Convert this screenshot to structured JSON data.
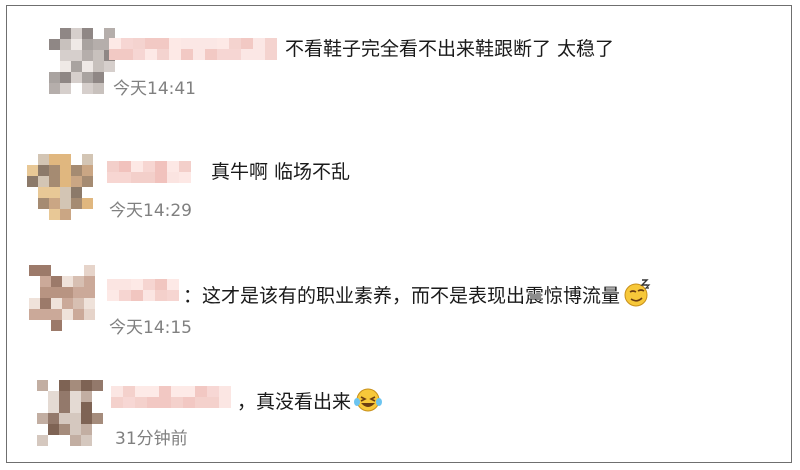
{
  "comments": [
    {
      "separator": "",
      "text": "不看鞋子完全看不出来鞋跟断了 太稳了",
      "time": "今天14:41",
      "emoji": "",
      "avatar_palette": [
        "#a9a3a0",
        "#d6cfcc",
        "#8f8785",
        "#c8c1bd",
        "#efe9e6",
        "#b5aeab"
      ],
      "name_palette": [
        "#f6d6d3",
        "#f2c9c4",
        "#fbe7e5",
        "#f4d3cf",
        "#fde9e6"
      ]
    },
    {
      "separator": "",
      "text": "真牛啊 临场不乱",
      "time": "今天14:29",
      "emoji": "",
      "avatar_palette": [
        "#caa684",
        "#e0b77f",
        "#a58b72",
        "#d3c5b4",
        "#8c7a6a",
        "#e8c896"
      ],
      "name_palette": [
        "#f7d6d2",
        "#f1c2bd",
        "#fbe4e1",
        "#f3cfca",
        "#fde8e5"
      ]
    },
    {
      "separator": "：",
      "text": "这才是该有的职业素养，而不是表现出震惊博流量",
      "time": "今天14:15",
      "emoji": "smirk-emoji",
      "avatar_palette": [
        "#d7bfb2",
        "#b89482",
        "#e6d4ca",
        "#9c7a6a",
        "#cba999",
        "#efe2da"
      ],
      "name_palette": [
        "#f6d5d1",
        "#f1c6c0",
        "#fbe5e2",
        "#f4d0cb",
        "#fde9e6"
      ]
    },
    {
      "separator": "，",
      "text": "真没看出来",
      "time": "31分钟前",
      "emoji": "laughing-tears-emoji",
      "avatar_palette": [
        "#a58c7c",
        "#c2aea2",
        "#7e6354",
        "#d5c8bf",
        "#93796b",
        "#e4dad3"
      ],
      "name_palette": [
        "#f7d7d4",
        "#f2c8c3",
        "#fbe6e3",
        "#f4d1cc",
        "#fdeae7"
      ]
    }
  ]
}
